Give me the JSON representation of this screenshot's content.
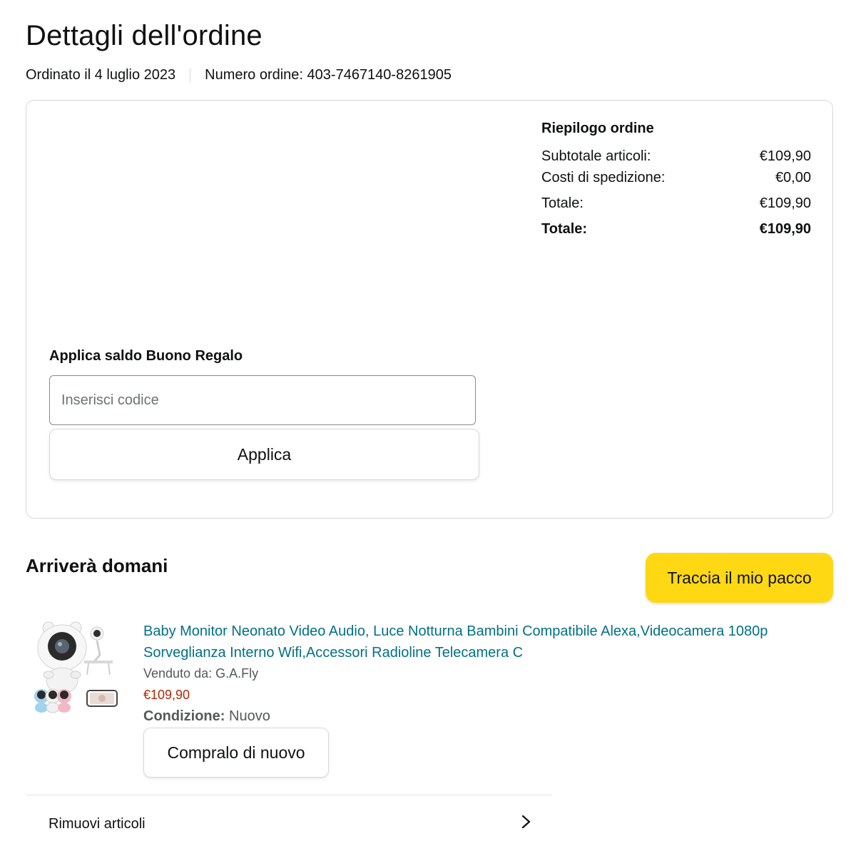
{
  "page": {
    "title": "Dettagli dell'ordine",
    "ordered_on": "Ordinato il 4 luglio 2023",
    "order_number": "Numero ordine: 403-7467140-8261905"
  },
  "summary": {
    "title": "Riepilogo ordine",
    "rows": [
      {
        "label": "Subtotale articoli:",
        "value": "€109,90"
      },
      {
        "label": "Costi di spedizione:",
        "value": "€0,00"
      },
      {
        "label": "Totale:",
        "value": "€109,90"
      },
      {
        "label": "Totale:",
        "value": "€109,90"
      }
    ]
  },
  "gift_card": {
    "label": "Applica saldo Buono Regalo",
    "placeholder": "Inserisci codice",
    "value": "",
    "apply_label": "Applica"
  },
  "shipment": {
    "status": "Arriverà domani",
    "track_label": "Traccia il mio pacco"
  },
  "product": {
    "image_icon": "baby-monitor-product-image",
    "title": "Baby Monitor Neonato Video Audio, Luce Notturna Bambini Compatibile Alexa,Videocamera 1080p Sorveglianza Interno Wifi,Accessori Radioline Telecamera C",
    "seller": "Venduto da: G.A.Fly",
    "price": "€109,90",
    "condition_label": "Condizione:",
    "condition_value": "Nuovo",
    "buy_again_label": "Compralo di nuovo"
  },
  "actions": {
    "remove_items_label": "Rimuovi articoli",
    "remove_icon": "chevron-right-icon"
  },
  "colors": {
    "link": "#007185",
    "price": "#b12704",
    "accent_yellow": "#ffd814"
  }
}
